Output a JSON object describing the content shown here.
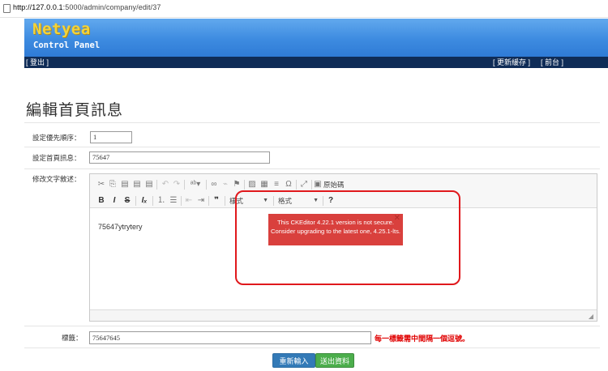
{
  "browser": {
    "url_host": "http://127.0.0.1",
    "url_path": ":5000/admin/company/edit/37"
  },
  "header": {
    "logo": "Netyea",
    "subtitle": "Control Panel"
  },
  "nav": {
    "logout": "[ 登出 ]",
    "refresh_cache": "[ 更新緩存 ]",
    "frontend": "[ 前台 ]"
  },
  "page_title": "編輯首頁訊息",
  "form": {
    "priority_label": "設定優先順序：",
    "priority_value": "1",
    "homepage_msg_label": "設定首頁訊息：",
    "homepage_msg_value": "75647",
    "content_label": "修改文字敘述：",
    "tags_label": "標籤：",
    "tags_value": "75647645",
    "tags_hint": "每一標籤需中間隔一個逗號。"
  },
  "editor": {
    "source_button": "原始碼",
    "format_combo": "樣式",
    "style_combo": "格式",
    "content_text": "75647ytrytery",
    "warning_text": "This CKEditor 4.22.1 version is not secure. Consider upgrading to the latest one, 4.25.1-lts.",
    "warning_close": "✕"
  },
  "buttons": {
    "reset": "重新輸入",
    "submit": "送出資料"
  },
  "colors": {
    "header_blue": "#3d8be0",
    "navbar_navy": "#0f2c57",
    "warning_red": "#d9403d",
    "highlight_red": "#e0181c",
    "reset_blue": "#337ab7",
    "submit_green": "#4cae4c"
  }
}
